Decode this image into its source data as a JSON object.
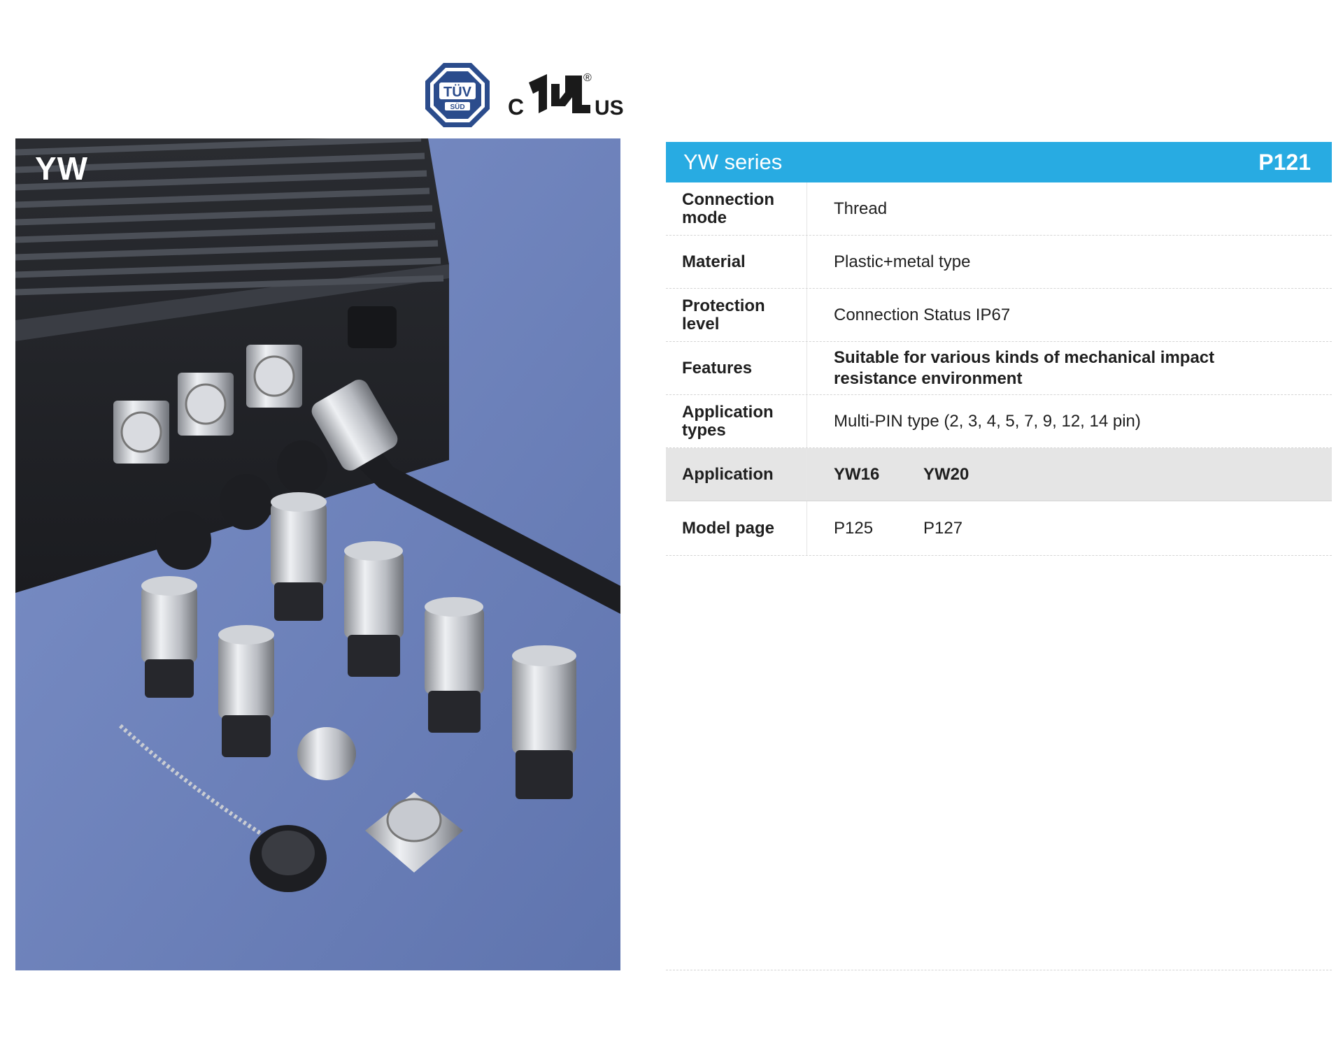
{
  "certifications": {
    "tuv": {
      "top": "TÜV",
      "bottom": "SÜD"
    },
    "ul": {
      "left": "C",
      "right": "US",
      "reg": "®"
    }
  },
  "photo": {
    "label": "YW"
  },
  "spec": {
    "title": "YW series",
    "page": "P121",
    "rows": {
      "connection": {
        "label": "Connection mode",
        "value": "Thread"
      },
      "material": {
        "label": "Material",
        "value": "Plastic+metal type"
      },
      "protection": {
        "label": "Protection level",
        "value": "Connection Status IP67"
      },
      "features": {
        "label": "Features",
        "value": "Suitable for various kinds of mechanical impact resistance environment"
      },
      "types": {
        "label": "Application types",
        "value": "Multi-PIN type (2, 3, 4, 5, 7, 9, 12, 14 pin)"
      },
      "application": {
        "label": "Application",
        "values": [
          "YW16",
          "YW20"
        ]
      },
      "model": {
        "label": "Model page",
        "values": [
          "P125",
          "P127"
        ]
      }
    }
  },
  "colors": {
    "accent": "#28abe2",
    "shaded": "#e5e5e5",
    "photo_bg": "#6f85bd"
  }
}
